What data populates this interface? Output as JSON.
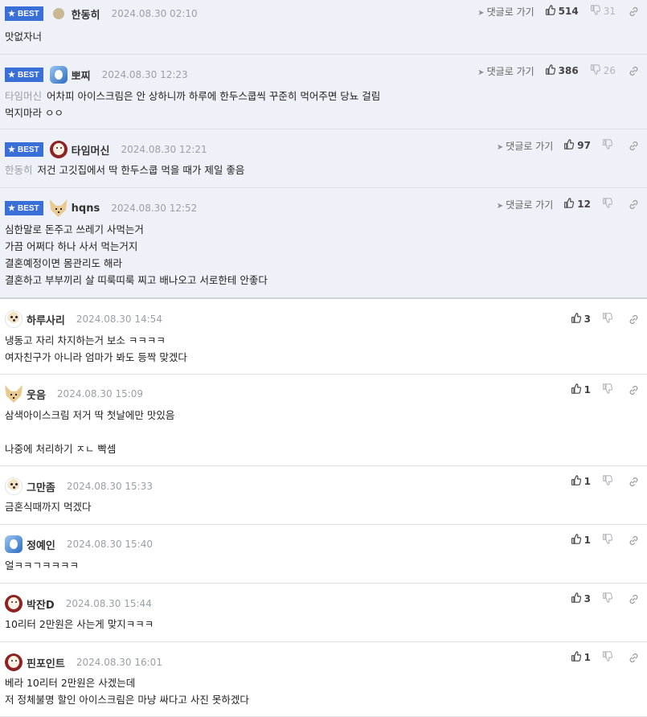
{
  "ui": {
    "best_label": "BEST",
    "goto_label": "댓글로 가기"
  },
  "comments": [
    {
      "best": true,
      "avatar": "dot",
      "name": "한동히",
      "date": "2024.08.30 02:10",
      "mention": "",
      "lines": [
        "맛없자너"
      ],
      "likes": "514",
      "dislikes": "31"
    },
    {
      "best": true,
      "avatar": "blue",
      "name": "뽀찌",
      "date": "2024.08.30 12:23",
      "mention": "타임머신",
      "lines": [
        "어차피 아이스크림은 안 상하니까 하루에 한두스쿱씩 꾸준히 먹어주면 당뇨 걸림",
        "먹지마라 ㅇㅇ"
      ],
      "likes": "386",
      "dislikes": "26"
    },
    {
      "best": true,
      "avatar": "red",
      "name": "타임머신",
      "date": "2024.08.30 12:21",
      "mention": "한동히",
      "lines": [
        "저건 고깃집에서 딱 한두스쿱 먹을 때가 제일 좋음"
      ],
      "likes": "97",
      "dislikes": ""
    },
    {
      "best": true,
      "avatar": "fox",
      "name": "hqns",
      "date": "2024.08.30 12:52",
      "mention": "",
      "lines": [
        "심한말로 돈주고 쓰레기 사먹는거",
        "가끔 어쩌다 하나 사서 먹는거지",
        "결혼예정이면 몸관리도 해라",
        "결혼하고 부부끼리 살 띠룩띠룩 찌고 배나오고 서로한테 안좋다"
      ],
      "likes": "12",
      "dislikes": ""
    },
    {
      "best": false,
      "avatar": "dog",
      "name": "하루사리",
      "date": "2024.08.30 14:54",
      "mention": "",
      "lines": [
        "냉동고 자리 차지하는거 보소 ㅋㅋㅋㅋ",
        "여자친구가 아니라 엄마가 봐도 등짝 맞겠다"
      ],
      "likes": "3",
      "dislikes": ""
    },
    {
      "best": false,
      "avatar": "fox",
      "name": "웃음",
      "date": "2024.08.30 15:09",
      "mention": "",
      "lines": [
        "삼색아이스크림 저거 딱 첫날에만 맛있음",
        "",
        "나중에 처리하기 ㅈㄴ 빡셈"
      ],
      "likes": "1",
      "dislikes": ""
    },
    {
      "best": false,
      "avatar": "dog",
      "name": "그만좀",
      "date": "2024.08.30 15:33",
      "mention": "",
      "lines": [
        "금혼식때까지 먹겠다"
      ],
      "likes": "1",
      "dislikes": ""
    },
    {
      "best": false,
      "avatar": "blue",
      "name": "정예인",
      "date": "2024.08.30 15:40",
      "mention": "",
      "lines": [
        "얼ㅋㅋㄱㅋㅋㅋㅋ"
      ],
      "likes": "1",
      "dislikes": ""
    },
    {
      "best": false,
      "avatar": "red",
      "name": "박잔D",
      "date": "2024.08.30 15:44",
      "mention": "",
      "lines": [
        "10리터 2만원은 사는게 맞지ㅋㅋㅋ"
      ],
      "likes": "3",
      "dislikes": ""
    },
    {
      "best": false,
      "avatar": "red",
      "name": "핀포인트",
      "date": "2024.08.30 16:01",
      "mention": "",
      "lines": [
        "베라 10리터 2만원은 사겠는데",
        "저 정체불명 할인 아이스크림은 마냥 싸다고 사진 못하겠다"
      ],
      "likes": "1",
      "dislikes": ""
    }
  ]
}
